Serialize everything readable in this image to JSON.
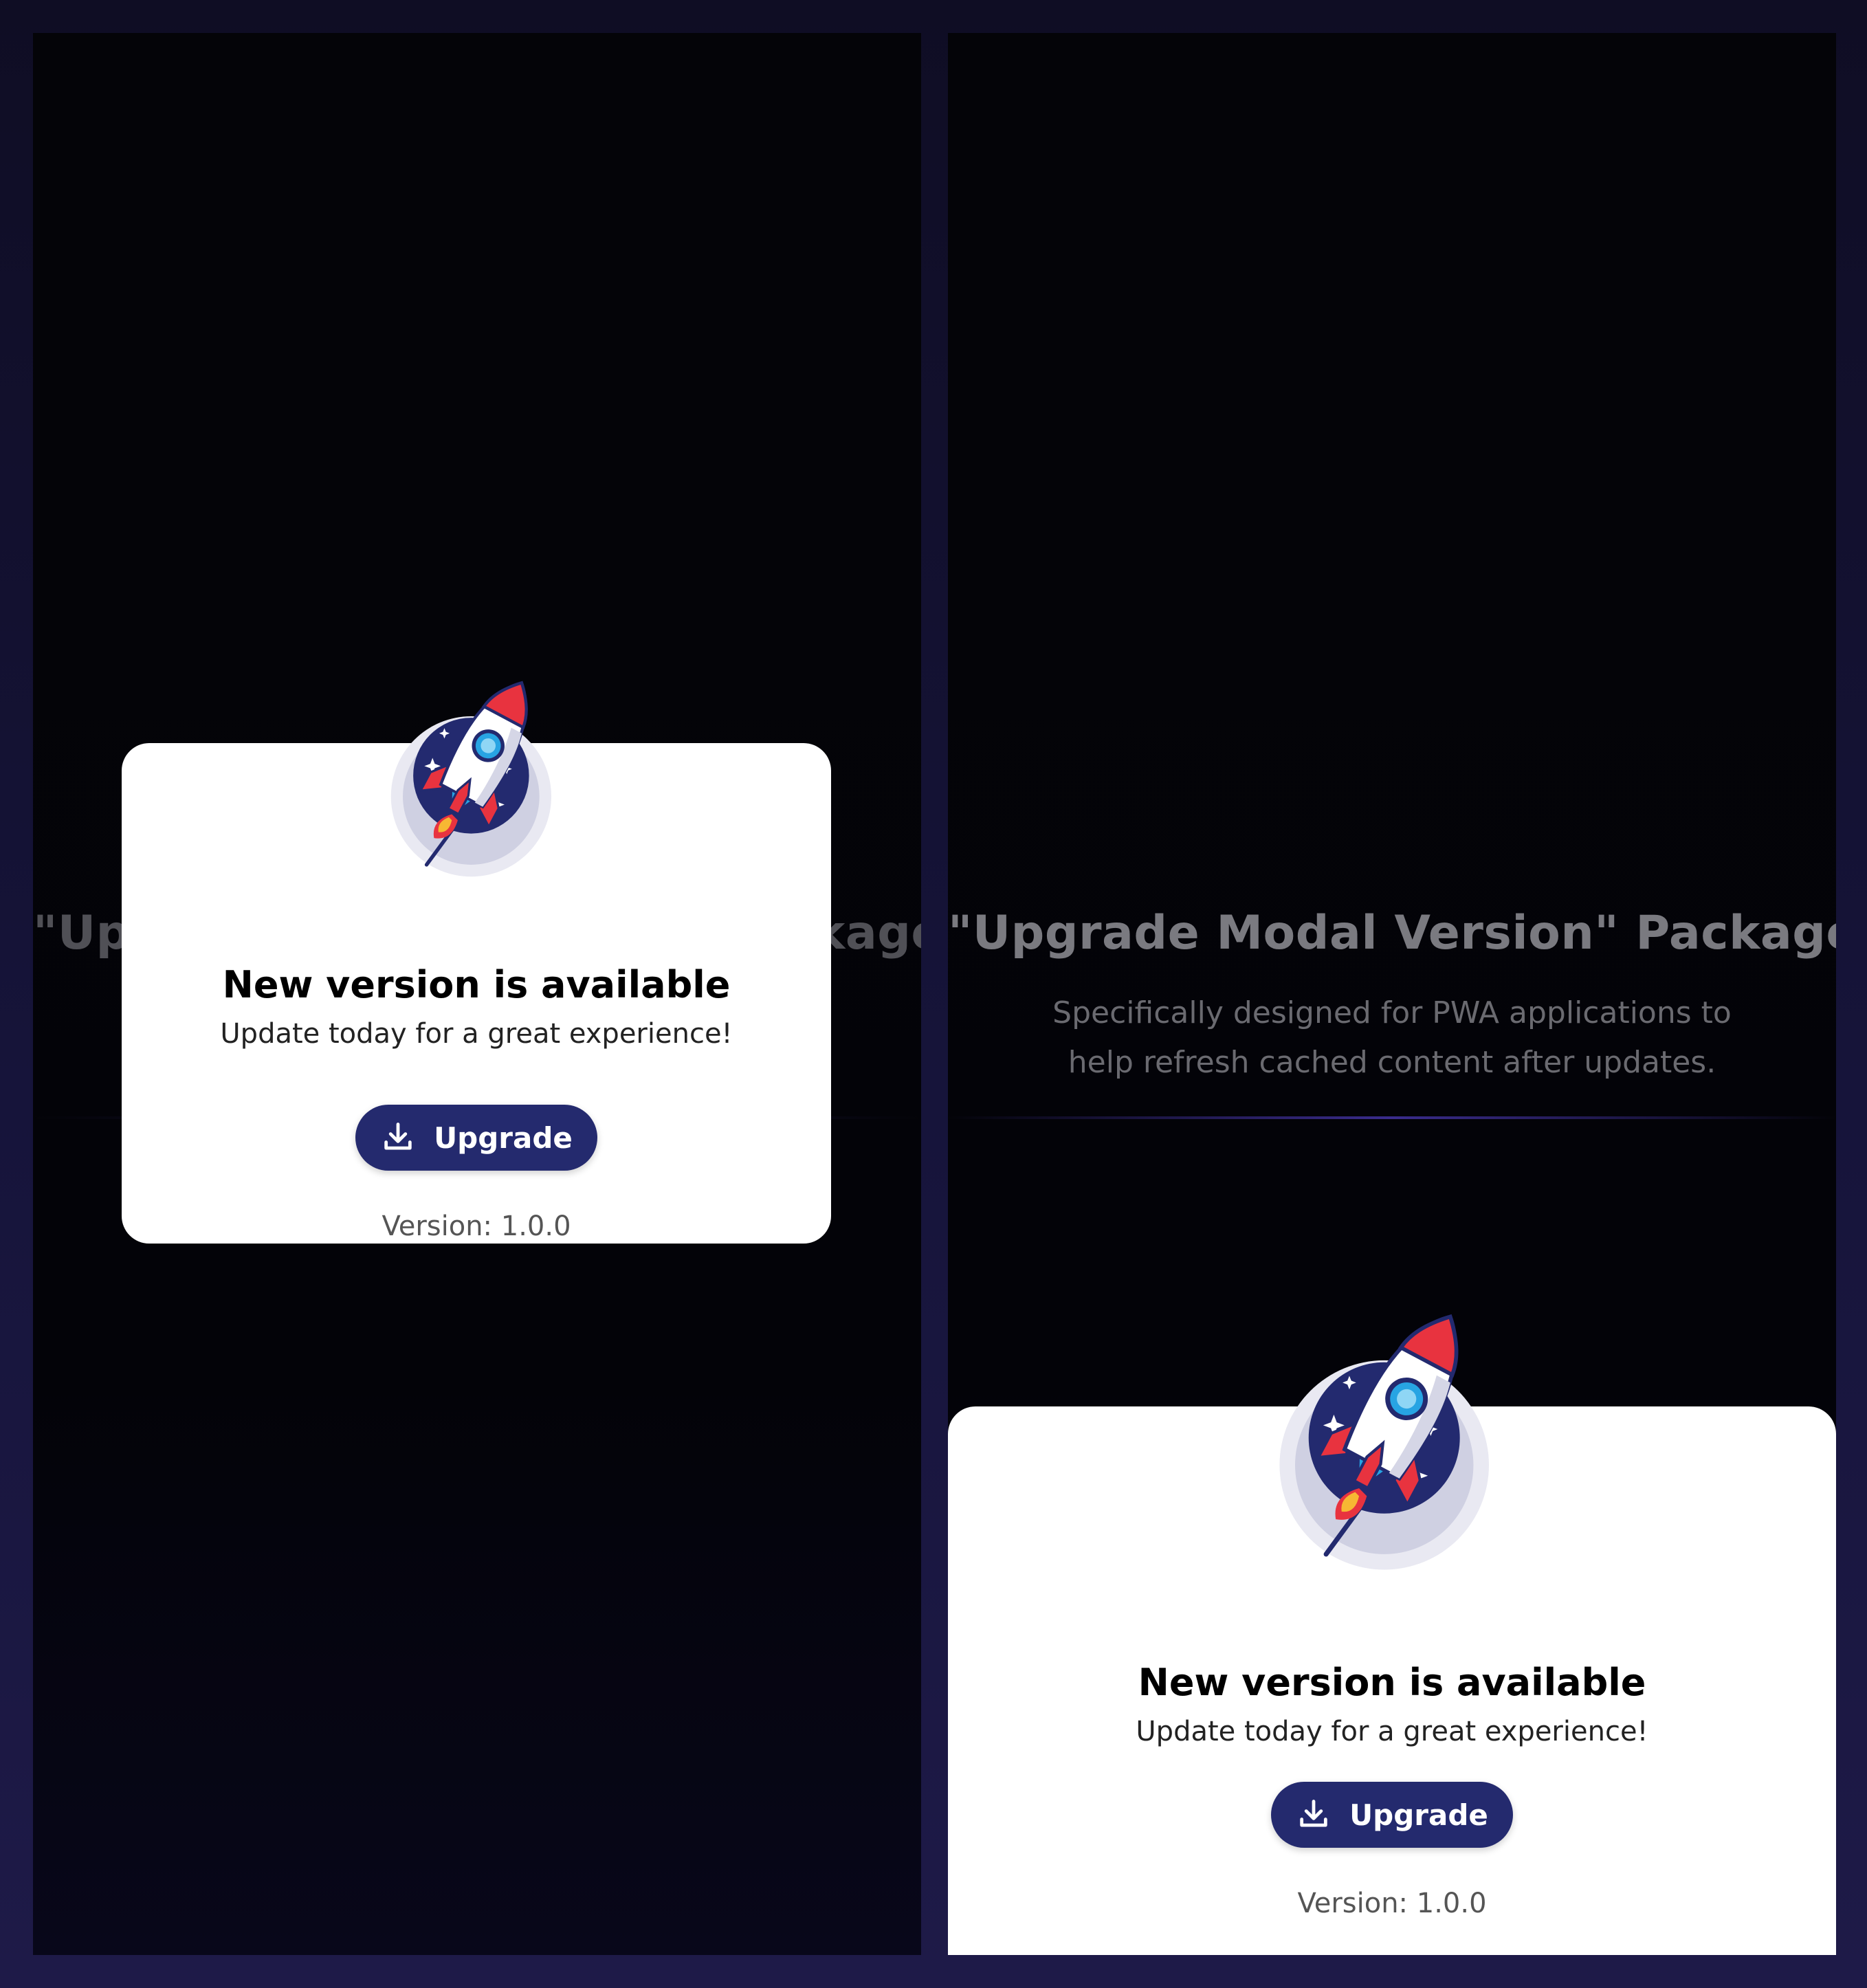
{
  "background_page": {
    "title": "\"Upgrade Modal Version\" Package",
    "subtitle": "Specifically designed for PWA applications to help refresh cached content after updates."
  },
  "modal": {
    "title": "New version is available",
    "subtitle": "Update today for a great experience!",
    "button_label": "Upgrade",
    "version_text": "Version: 1.0.0",
    "illustration": "rocket-illustration",
    "button_icon": "download-icon"
  },
  "colors": {
    "button": "#242a6e",
    "rocket_circle": "#232a6f",
    "rocket_red": "#e8333f",
    "card": "#ffffff"
  }
}
